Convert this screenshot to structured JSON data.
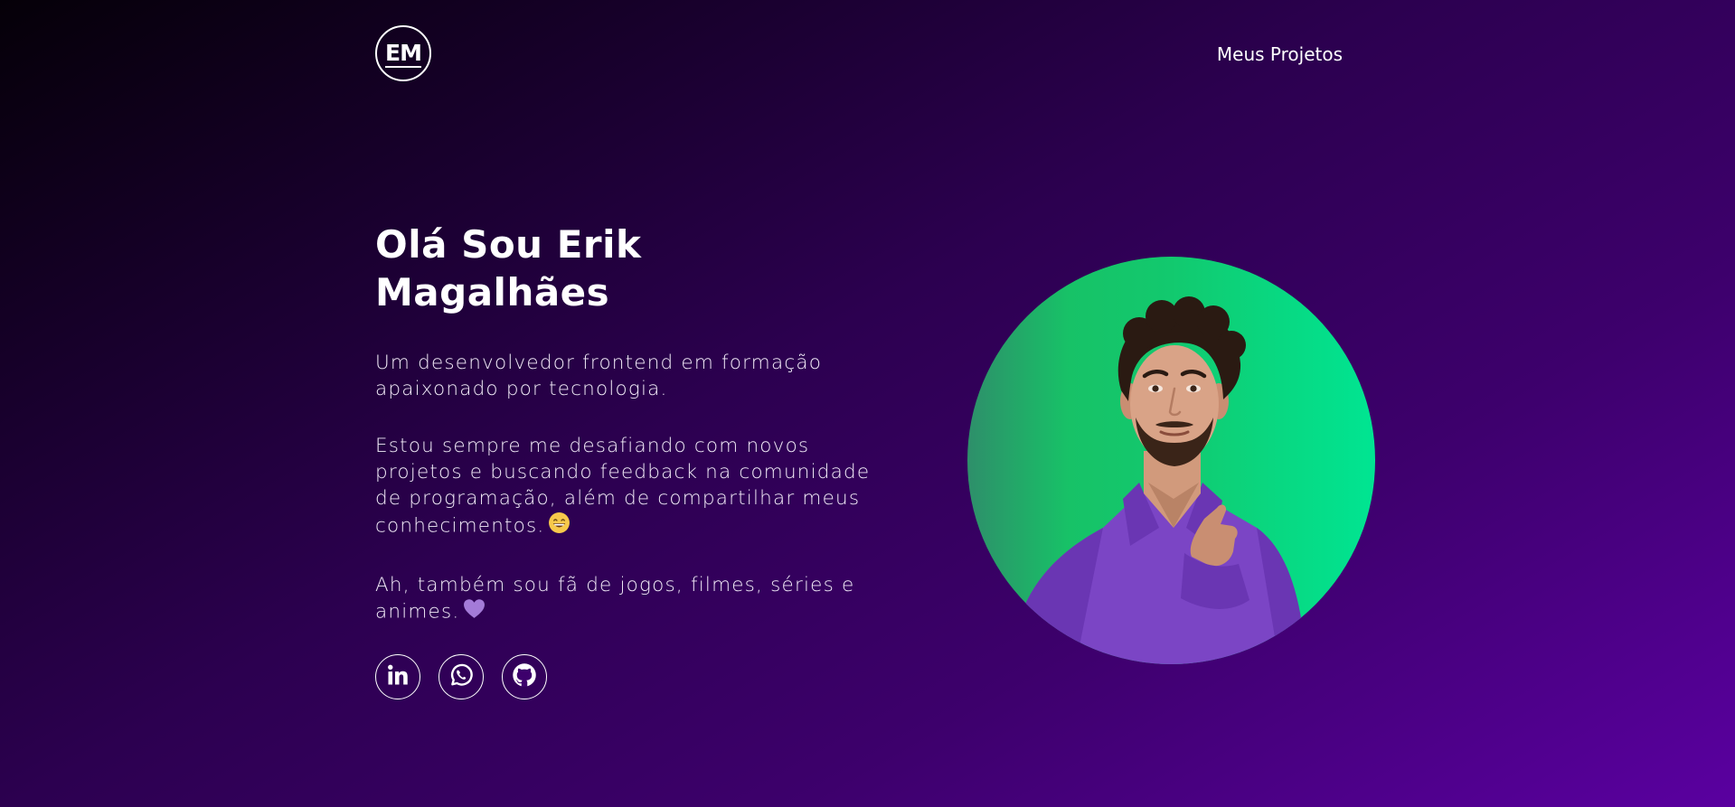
{
  "header": {
    "logo_text": "EM",
    "nav_link": "Meus Projetos"
  },
  "intro": {
    "title": "Olá Sou Erik Magalhães",
    "paragraph1": "Um desenvolvedor frontend em formação apaixonado por tecnologia.",
    "paragraph2": "Estou sempre me desafiando com novos projetos e buscando feedback na comunidade de programação, além de compartilhar meus conhecimentos.",
    "paragraph3": "Ah, também sou fã de jogos, filmes, séries e animes."
  },
  "icons": {
    "grin_emoji": "grinning-face-emoji",
    "heart_emoji": "purple-heart-emoji",
    "socials": [
      "linkedin-icon",
      "whatsapp-icon",
      "github-icon"
    ]
  },
  "colors": {
    "background_start": "#050008",
    "background_end": "#5a00a0",
    "photo_bg_start": "#17c267",
    "photo_bg_end": "#00e592",
    "shirt": "#7b45c5"
  }
}
